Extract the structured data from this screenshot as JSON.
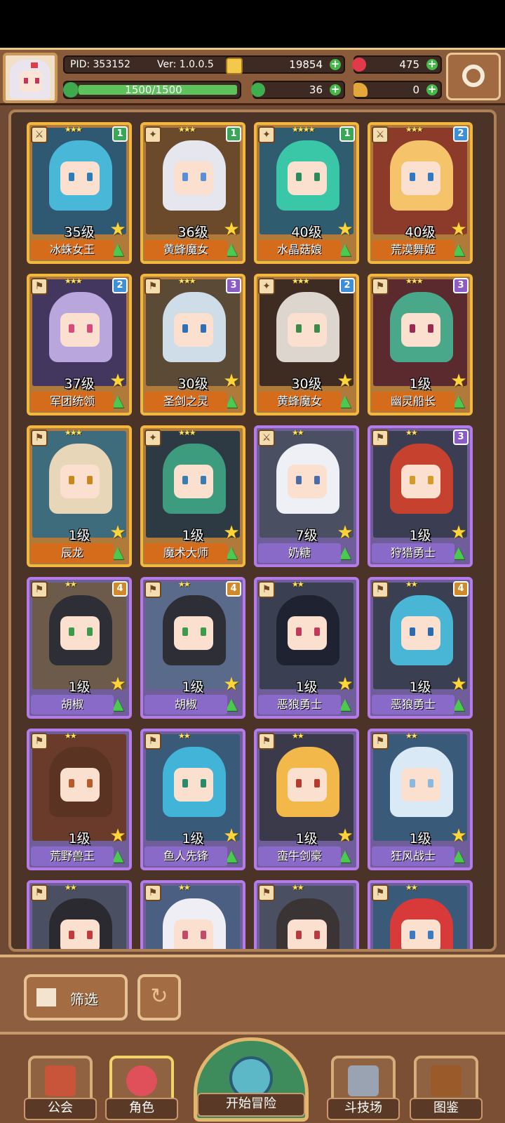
{
  "header": {
    "pid_label": "PID: 353152",
    "version": "Ver: 1.0.0.5",
    "coins": "19854",
    "gems": "475",
    "energy": "1500/1500",
    "clover": "36",
    "keys": "0"
  },
  "cards": [
    {
      "name": "冰蛛女王",
      "level": "35级",
      "stars": "★★★",
      "badge": "1",
      "rarity": "gold",
      "role": "⚔",
      "hair": "#49b8d8",
      "eye": "#2c7db6",
      "bg": "#2f5873"
    },
    {
      "name": "黄蜂魔女",
      "level": "36级",
      "stars": "★★★",
      "badge": "1",
      "rarity": "gold",
      "role": "✦",
      "hair": "#e6e6ef",
      "eye": "#5a8ed6",
      "bg": "#6b4a2c"
    },
    {
      "name": "水晶菇娘",
      "level": "40级",
      "stars": "★★★★",
      "badge": "1",
      "rarity": "gold",
      "role": "✦",
      "hair": "#39c7a8",
      "eye": "#2c8a5c",
      "bg": "#2f5d6f"
    },
    {
      "name": "荒漠舞姬",
      "level": "40级",
      "stars": "★★★",
      "badge": "2",
      "rarity": "gold",
      "role": "⚔",
      "hair": "#f5c46a",
      "eye": "#2f78c4",
      "bg": "#8c3a2a"
    },
    {
      "name": "军团统领",
      "level": "37级",
      "stars": "★★★",
      "badge": "2",
      "rarity": "gold",
      "role": "⚑",
      "hair": "#b9a6dc",
      "eye": "#d64a7c",
      "bg": "#44375f"
    },
    {
      "name": "圣剑之灵",
      "level": "30级",
      "stars": "★★★",
      "badge": "3",
      "rarity": "gold",
      "role": "⚑",
      "hair": "#cfdde8",
      "eye": "#2e6fb6",
      "bg": "#5a4a36"
    },
    {
      "name": "黄蜂魔女",
      "level": "30级",
      "stars": "★★★",
      "badge": "2",
      "rarity": "gold",
      "role": "✦",
      "hair": "#dcd6cf",
      "eye": "#3e8a4a",
      "bg": "#3e2c22"
    },
    {
      "name": "幽灵船长",
      "level": "1级",
      "stars": "★★★",
      "badge": "3",
      "rarity": "gold",
      "role": "⚑",
      "hair": "#4aa88a",
      "eye": "#9b2a52",
      "bg": "#5a2a2f"
    },
    {
      "name": "辰龙",
      "level": "1级",
      "stars": "★★★",
      "badge": "",
      "rarity": "gold",
      "role": "⚑",
      "hair": "#e8d6b8",
      "eye": "#c7881e",
      "bg": "#3f6c7c"
    },
    {
      "name": "魔术大师",
      "level": "1级",
      "stars": "★★★",
      "badge": "",
      "rarity": "gold",
      "role": "✦",
      "hair": "#3d9c7e",
      "eye": "#3a7bb0",
      "bg": "#2d3a44"
    },
    {
      "name": "奶糖",
      "level": "7级",
      "stars": "★★",
      "badge": "",
      "rarity": "purple",
      "role": "⚔",
      "hair": "#eef0f6",
      "eye": "#4a6ca8",
      "bg": "#4a4f62"
    },
    {
      "name": "狩猎勇士",
      "level": "1级",
      "stars": "★★",
      "badge": "3",
      "rarity": "purple",
      "role": "⚑",
      "hair": "#c7422e",
      "eye": "#d69a2a",
      "bg": "#3b3d52"
    },
    {
      "name": "胡椒",
      "level": "1级",
      "stars": "★★",
      "badge": "4",
      "rarity": "purple",
      "role": "⚑",
      "hair": "#2e2e36",
      "eye": "#3c9a4a",
      "bg": "#6c5a4a"
    },
    {
      "name": "胡椒",
      "level": "1级",
      "stars": "★★",
      "badge": "4",
      "rarity": "purple",
      "role": "⚑",
      "hair": "#2e2e36",
      "eye": "#3c9a4a",
      "bg": "#5a6a8a"
    },
    {
      "name": "恶狼勇士",
      "level": "1级",
      "stars": "★★",
      "badge": "",
      "rarity": "purple",
      "role": "⚑",
      "hair": "#1f2230",
      "eye": "#c23a5a",
      "bg": "#3a3f52"
    },
    {
      "name": "恶狼勇士",
      "level": "1级",
      "stars": "★★",
      "badge": "4",
      "rarity": "purple",
      "role": "⚑",
      "hair": "#49b6d6",
      "eye": "#2a6ab0",
      "bg": "#3a3f52"
    },
    {
      "name": "荒野兽王",
      "level": "1级",
      "stars": "★★",
      "badge": "",
      "rarity": "purple",
      "role": "⚑",
      "hair": "#5a3322",
      "eye": "#b85a2a",
      "bg": "#6a3a2a"
    },
    {
      "name": "鱼人先锋",
      "level": "1级",
      "stars": "★★",
      "badge": "",
      "rarity": "purple",
      "role": "⚑",
      "hair": "#42b4d8",
      "eye": "#2a8a6a",
      "bg": "#3a5a7a"
    },
    {
      "name": "蛮牛剑豪",
      "level": "1级",
      "stars": "★★",
      "badge": "",
      "rarity": "purple",
      "role": "⚑",
      "hair": "#f2b84a",
      "eye": "#b83a2a",
      "bg": "#3a3a4a"
    },
    {
      "name": "狂风战士",
      "level": "1级",
      "stars": "★★",
      "badge": "",
      "rarity": "purple",
      "role": "⚑",
      "hair": "#d9eaf6",
      "eye": "#8ab8de",
      "bg": "#3a5a7a"
    },
    {
      "name": "",
      "level": "",
      "stars": "★★",
      "badge": "",
      "rarity": "purple",
      "role": "⚑",
      "hair": "#2a2a30",
      "eye": "#c23a3a",
      "bg": "#4a4f62"
    },
    {
      "name": "",
      "level": "",
      "stars": "★★",
      "badge": "",
      "rarity": "purple",
      "role": "⚑",
      "hair": "#eeeef4",
      "eye": "#c24a6a",
      "bg": "#4a5f82"
    },
    {
      "name": "",
      "level": "",
      "stars": "★★",
      "badge": "",
      "rarity": "purple",
      "role": "⚑",
      "hair": "#3a3434",
      "eye": "#b83a3a",
      "bg": "#4a4f62"
    },
    {
      "name": "",
      "level": "",
      "stars": "★★",
      "badge": "",
      "rarity": "purple",
      "role": "⚑",
      "hair": "#d83a3a",
      "eye": "#3a7ac2",
      "bg": "#3a5a7a"
    }
  ],
  "filter": {
    "label": "筛选"
  },
  "nav": {
    "guild": "公会",
    "character": "角色",
    "adventure": "开始冒险",
    "arena": "斗技场",
    "codex": "图鉴"
  },
  "colors": {
    "badge_green": "#3ba55a",
    "badge_blue": "#3f8fd6",
    "badge_purple": "#8b5cc8",
    "badge_orange": "#d08a2a"
  }
}
